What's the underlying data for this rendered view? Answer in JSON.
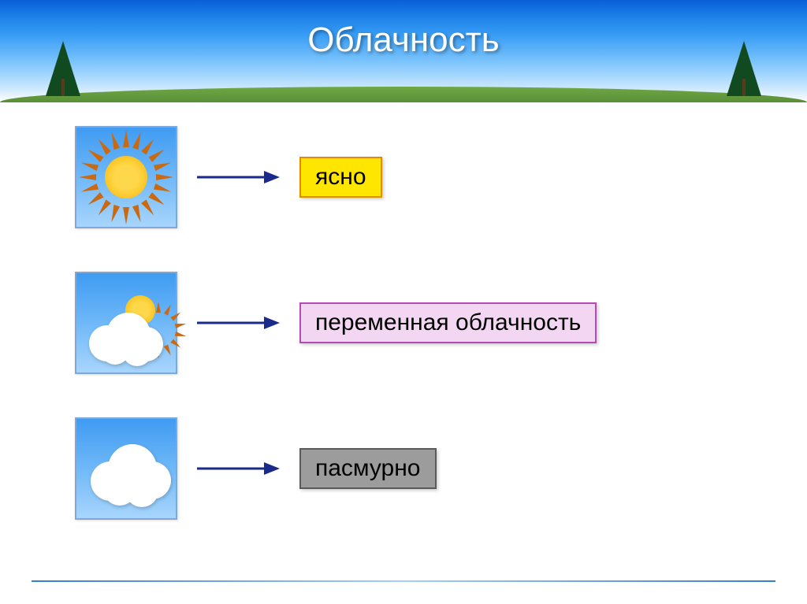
{
  "title": "Облачность",
  "rows": [
    {
      "label": "ясно",
      "box": {
        "bg": "#ffe600",
        "border": "#e28a00",
        "color": "#000000"
      }
    },
    {
      "label": "переменная облачность",
      "box": {
        "bg": "#f2d6f2",
        "border": "#b44ab4",
        "color": "#000000"
      }
    },
    {
      "label": "пасмурно",
      "box": {
        "bg": "#9c9c9c",
        "border": "#5a5a5a",
        "color": "#000000"
      }
    }
  ],
  "colors": {
    "arrow": "#1a2a8a"
  }
}
